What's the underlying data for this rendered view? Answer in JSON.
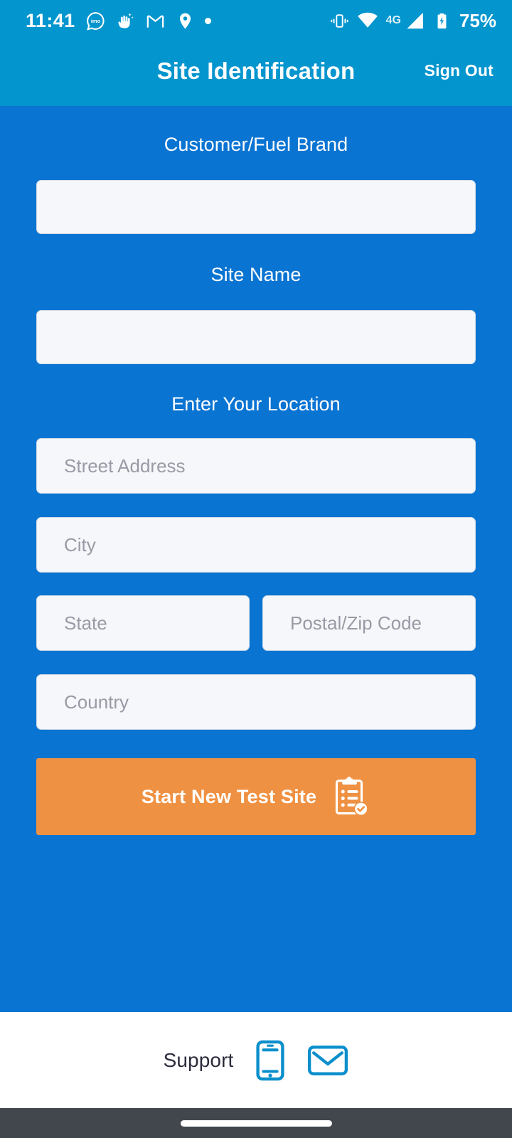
{
  "status_bar": {
    "time": "11:41",
    "battery_percent": "75%",
    "network_type": "4G",
    "left_icons": [
      "imo-icon",
      "hand-sparkle-icon",
      "gmail-icon",
      "location-pin-icon",
      "dot-icon"
    ],
    "right_icons": [
      "vibrate-icon",
      "wifi-icon",
      "network-label",
      "signal-bars-icon",
      "battery-charging-icon"
    ]
  },
  "app_bar": {
    "title": "Site Identification",
    "sign_out_label": "Sign Out",
    "background_color": "#0295ce"
  },
  "form": {
    "background_color": "#0a74d2",
    "customer_brand": {
      "label": "Customer/Fuel Brand",
      "value": "",
      "placeholder": ""
    },
    "site_name": {
      "label": "Site Name",
      "value": "",
      "placeholder": ""
    },
    "location": {
      "label": "Enter Your Location",
      "street": {
        "value": "",
        "placeholder": "Street Address"
      },
      "city": {
        "value": "",
        "placeholder": "City"
      },
      "state": {
        "value": "",
        "placeholder": "State"
      },
      "postal": {
        "value": "",
        "placeholder": "Postal/Zip Code"
      },
      "country": {
        "value": "",
        "placeholder": "Country"
      }
    }
  },
  "primary_action": {
    "label": "Start New Test Site",
    "icon": "clipboard-check-icon",
    "color": "#ef9142"
  },
  "footer": {
    "support_label": "Support",
    "phone_icon": "mobile-phone-icon",
    "email_icon": "envelope-icon",
    "icon_color": "#0a8fcc"
  },
  "system_nav": {
    "background_color": "#41474d",
    "gesture_pill": "home-gesture-pill"
  }
}
